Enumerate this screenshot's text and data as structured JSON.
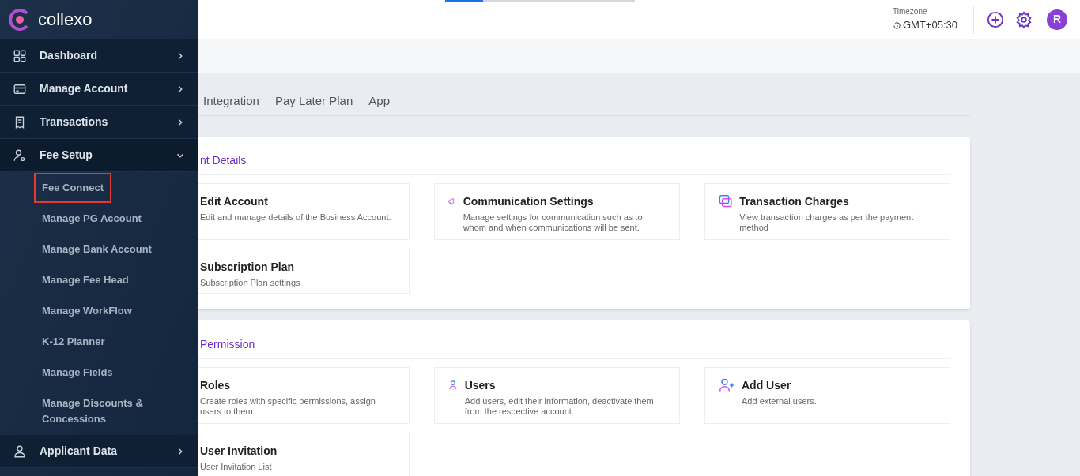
{
  "brand": {
    "name": "collexo"
  },
  "sidebar": {
    "items": [
      {
        "label": "Dashboard",
        "kind": "dashboard",
        "expanded": false
      },
      {
        "label": "Manage Account",
        "kind": "account",
        "expanded": false
      },
      {
        "label": "Transactions",
        "kind": "transactions",
        "expanded": false
      },
      {
        "label": "Fee Setup",
        "kind": "setup",
        "expanded": true,
        "children": [
          {
            "label": "Fee Connect",
            "selected": true
          },
          {
            "label": "Manage PG Account",
            "selected": false
          },
          {
            "label": "Manage Bank Account",
            "selected": false
          },
          {
            "label": "Manage Fee Head",
            "selected": false
          },
          {
            "label": "Manage WorkFlow",
            "selected": false
          },
          {
            "label": "K-12 Planner",
            "selected": false
          },
          {
            "label": "Manage Fields",
            "selected": false
          },
          {
            "label": "Manage Discounts & Concessions",
            "selected": false
          }
        ]
      },
      {
        "label": "Applicant Data",
        "kind": "applicant",
        "expanded": false
      }
    ]
  },
  "header": {
    "progress": {
      "level": 0.2
    },
    "timezone_label": "Timezone",
    "timezone": "GMT+05:30",
    "avatar": "R"
  },
  "tabs": [
    {
      "label": "Integration",
      "selected": false
    },
    {
      "label": "Pay Later Plan",
      "selected": false
    },
    {
      "label": "App",
      "selected": false
    }
  ],
  "sections": [
    {
      "title": "nt Details",
      "cards": [
        {
          "title": "Edit Account",
          "description": "Edit and manage details of the Business Account."
        },
        {
          "title": "Communication Settings",
          "description": "Manage settings for communication such as to whom and when communications will be sent.",
          "kind": "communication"
        },
        {
          "title": "Transaction Charges",
          "description": "View transaction charges as per the payment method",
          "kind": "charges"
        },
        {
          "title": "Subscription Plan",
          "description": "Subscription Plan settings"
        }
      ]
    },
    {
      "title": "Permission",
      "cards": [
        {
          "title": "Roles",
          "description": "Create roles with specific permissions, assign users to them."
        },
        {
          "title": "Users",
          "description": "Add users, edit their information, deactivate them from the respective account.",
          "kind": "users"
        },
        {
          "title": "Add User",
          "description": "Add external users.",
          "kind": "add-user"
        },
        {
          "title": "User Invitation",
          "description": "User Invitation List"
        }
      ]
    }
  ]
}
